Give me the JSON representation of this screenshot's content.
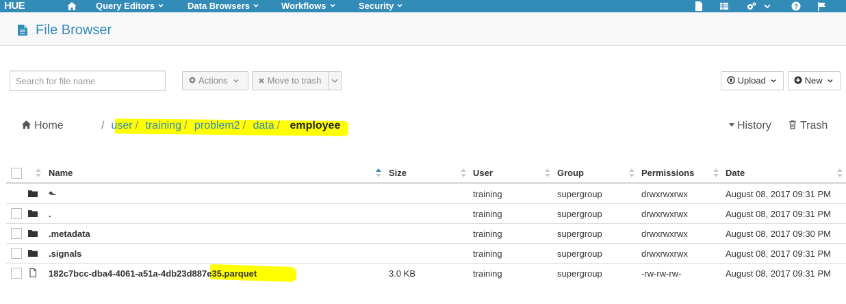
{
  "navbar": {
    "logo": "HUE",
    "menus": [
      {
        "label": "Query Editors"
      },
      {
        "label": "Data Browsers"
      },
      {
        "label": "Workflows"
      },
      {
        "label": "Security"
      }
    ],
    "right_icons": [
      "file-icon",
      "table-icon",
      "cogs-icon",
      "help-icon",
      "flag-icon"
    ],
    "color": "#338bb8"
  },
  "header": {
    "title": "File Browser"
  },
  "toolbar": {
    "search_placeholder": "Search for file name",
    "actions_label": "Actions",
    "move_to_trash_label": "Move to trash",
    "upload_label": "Upload",
    "new_label": "New"
  },
  "breadcrumb": {
    "home_label": "Home",
    "separator": "/",
    "segments": [
      "user",
      "training",
      "problem2",
      "data"
    ],
    "current": "employee",
    "history_label": "History",
    "trash_label": "Trash"
  },
  "table": {
    "columns": [
      "Name",
      "Size",
      "User",
      "Group",
      "Permissions",
      "Date"
    ],
    "rows": [
      {
        "type": "folder",
        "name": "⬑",
        "size": "",
        "user": "training",
        "group": "supergroup",
        "permissions": "drwxrwxrwx",
        "date": "August 08, 2017 09:31 PM"
      },
      {
        "type": "folder",
        "name": ".",
        "size": "",
        "user": "training",
        "group": "supergroup",
        "permissions": "drwxrwxrwx",
        "date": "August 08, 2017 09:31 PM"
      },
      {
        "type": "folder",
        "name": ".metadata",
        "size": "",
        "user": "training",
        "group": "supergroup",
        "permissions": "drwxrwxrwx",
        "date": "August 08, 2017 09:30 PM"
      },
      {
        "type": "folder",
        "name": ".signals",
        "size": "",
        "user": "training",
        "group": "supergroup",
        "permissions": "drwxrwxrwx",
        "date": "August 08, 2017 09:31 PM"
      },
      {
        "type": "file",
        "name": "182c7bcc-dba4-4061-a51a-4db23d887e35.parquet",
        "size": "3.0 KB",
        "user": "training",
        "group": "supergroup",
        "permissions": "-rw-rw-rw-",
        "date": "August 08, 2017 09:31 PM"
      }
    ]
  },
  "highlight_color": "#ffff00"
}
